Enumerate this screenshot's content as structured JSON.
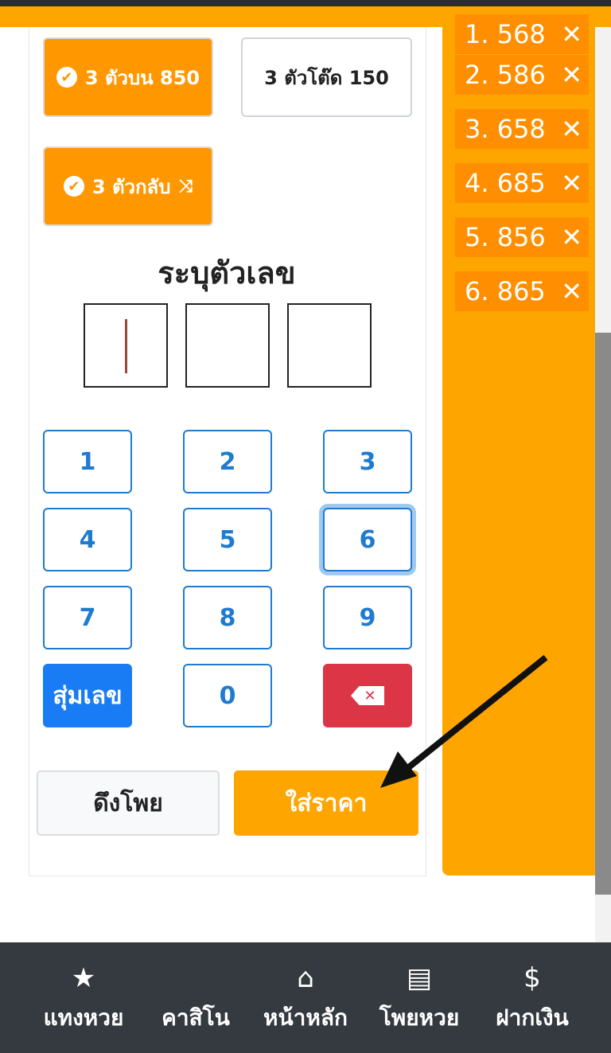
{
  "header": {
    "title": "ระบุตัวเลข"
  },
  "bet_types": [
    {
      "label": "3 ตัวบน 850",
      "active": true,
      "icon": "check-circle-icon"
    },
    {
      "label": "3 ตัวโต๊ด 150",
      "active": false
    },
    {
      "label": "3 ตัวกลับ",
      "active": true,
      "icon": "check-circle-icon",
      "trailing_icon": "shuffle-icon"
    }
  ],
  "entry": {
    "title": "ระบุตัวเลข",
    "digits": [
      "",
      "",
      ""
    ]
  },
  "keypad": {
    "keys": [
      "1",
      "2",
      "3",
      "4",
      "5",
      "6",
      "7",
      "8",
      "9"
    ],
    "random_label": "สุ่มเลข",
    "zero": "0",
    "delete_icon": "backspace-icon",
    "focused_key": "6"
  },
  "actions": {
    "pull_label": "ดึงโพย",
    "price_label": "ใส่ราคา"
  },
  "selected_numbers": [
    {
      "label": "1. 568"
    },
    {
      "label": "2. 586"
    },
    {
      "label": "3. 658"
    },
    {
      "label": "4. 685"
    },
    {
      "label": "5. 856"
    },
    {
      "label": "6. 865"
    }
  ],
  "bottom_nav": [
    {
      "label": "แทงหวย",
      "icon": "star-icon"
    },
    {
      "label": "คาสิโน",
      "icon": ""
    },
    {
      "label": "หน้าหลัก",
      "icon": "home-icon"
    },
    {
      "label": "โพยหวย",
      "icon": "document-icon"
    },
    {
      "label": "ฝากเงิน",
      "icon": "money-deposit-icon"
    }
  ],
  "colors": {
    "accent": "#ffa500",
    "primary": "#1e7bd0",
    "danger": "#dc3545",
    "nav_bg": "#353a40"
  }
}
